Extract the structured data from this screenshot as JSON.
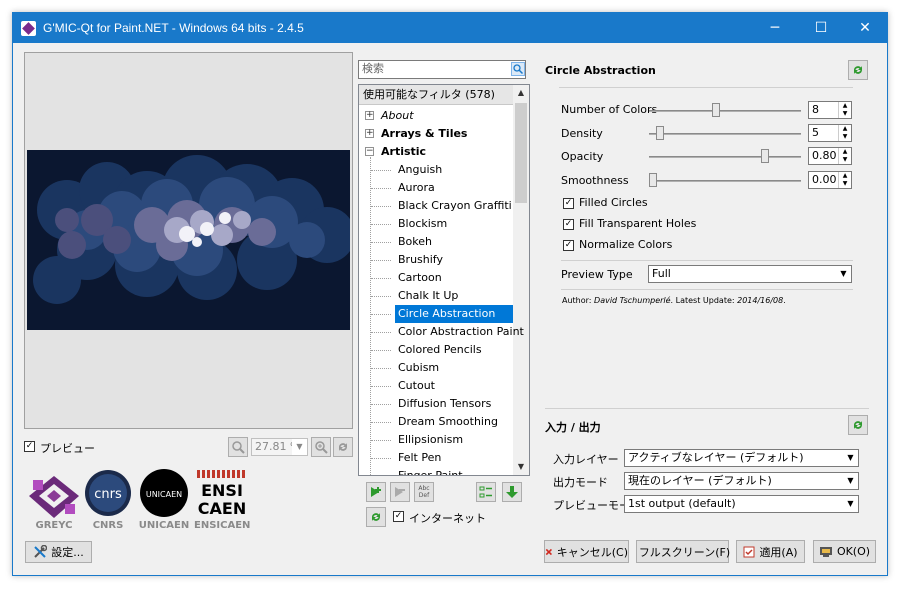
{
  "window": {
    "title": "G'MIC-Qt for Paint.NET - Windows 64 bits - 2.4.5",
    "minimize": "─",
    "maximize": "☐",
    "close": "✕"
  },
  "preview": {
    "checkbox_checked": "✓",
    "label": "プレビュー",
    "zoom_value": "27.81 %"
  },
  "logos": {
    "greyc": "GREYC",
    "cnrs_mark": "cnrs",
    "cnrs": "CNRS",
    "unicaen_mark": "UNICAEN",
    "unicaen": "UNICAEN",
    "ensicaen_mark_1": "ENSI",
    "ensicaen_mark_2": "CAEN",
    "ensicaen": "ENSICAEN"
  },
  "settings_button": "設定...",
  "search": {
    "placeholder": "検索"
  },
  "tree": {
    "header": "使用可能なフィルタ (578)",
    "groups": [
      {
        "expander": "+",
        "label": "About"
      },
      {
        "expander": "+",
        "label": "Arrays & Tiles"
      },
      {
        "expander": "−",
        "label": "Artistic"
      }
    ],
    "filters": [
      "Anguish",
      "Aurora",
      "Black Crayon Graffiti",
      "Blockism",
      "Bokeh",
      "Brushify",
      "Cartoon",
      "Chalk It Up",
      "Circle Abstraction",
      "Color Abstraction Paint",
      "Colored Pencils",
      "Cubism",
      "Cutout",
      "Diffusion Tensors",
      "Dream Smoothing",
      "Ellipsionism",
      "Felt Pen",
      "Finger Paint"
    ],
    "selected_index": 8
  },
  "filter_toolbar": {
    "internet_checked": "✓",
    "internet_label": "インターネット",
    "abc_def": "Abc Def"
  },
  "params": {
    "title": "Circle Abstraction",
    "number_of_colors": {
      "label": "Number of Colors",
      "value": "8",
      "fraction": 0.44
    },
    "density": {
      "label": "Density",
      "value": "5",
      "fraction": 0.05
    },
    "opacity": {
      "label": "Opacity",
      "value": "0.80",
      "fraction": 0.78
    },
    "smoothness": {
      "label": "Smoothness",
      "value": "0.00",
      "fraction": 0.0
    },
    "filled_circles": {
      "label": "Filled Circles",
      "check": "✓"
    },
    "fill_transparent_holes": {
      "label": "Fill Transparent Holes",
      "check": "✓"
    },
    "normalize_colors": {
      "label": "Normalize Colors",
      "check": "✓"
    },
    "preview_type": {
      "label": "Preview Type",
      "value": "Full"
    },
    "author_prefix": "Author: ",
    "author": "David Tschumperlé",
    "update_prefix": ". Latest Update: ",
    "update": "2014/16/08",
    "update_suffix": "."
  },
  "io": {
    "title": "入力 / 出力",
    "input_layer": {
      "label": "入力レイヤー",
      "value": "アクティブなレイヤー (デフォルト)"
    },
    "output_mode": {
      "label": "出力モード",
      "value": "現在のレイヤー (デフォルト)"
    },
    "preview_mode": {
      "label": "プレビューモード",
      "value": "1st output (default)"
    }
  },
  "buttons": {
    "cancel": "キャンセル(C)",
    "fullscreen": "フルスクリーン(F)",
    "apply": "適用(A)",
    "ok": "OK(O)"
  },
  "colors": {
    "titlebar": "#1979ca",
    "selection": "#0078d7",
    "green_icon": "#2e9a2e"
  }
}
